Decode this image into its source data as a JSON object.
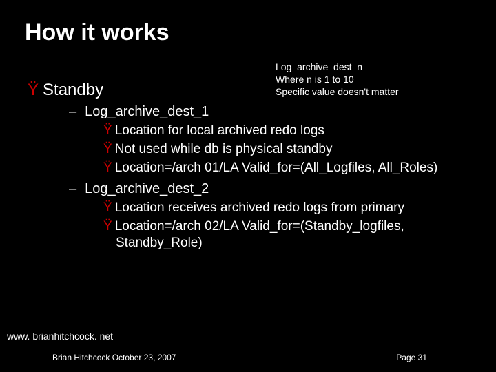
{
  "title": "How it works",
  "note": {
    "line1": "Log_archive_dest_n",
    "line2": "Where n is 1 to 10",
    "line3": "Specific value doesn't matter"
  },
  "main_bullet": "Standby",
  "section1": {
    "heading": "Log_archive_dest_1",
    "items": [
      "Location for local archived redo logs",
      "Not used while db is physical standby",
      "Location=/arch 01/LA Valid_for=(All_Logfiles, All_Roles)"
    ]
  },
  "section2": {
    "heading": "Log_archive_dest_2",
    "items": [
      "Location receives archived redo logs from primary",
      "Location=/arch 02/LA Valid_for=(Standby_logfiles, Standby_Role)"
    ]
  },
  "url": "www. brianhitchcock. net",
  "footer_left": "Brian Hitchcock  October 23, 2007",
  "footer_right": "Page 31",
  "glyphs": {
    "y_bullet": "Ÿ",
    "dash": "–"
  }
}
